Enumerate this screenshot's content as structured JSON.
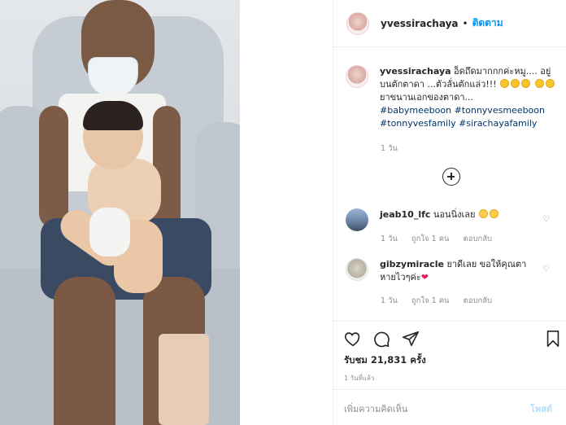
{
  "post": {
    "username": "yvessirachaya",
    "follow_label": "ติดตาม",
    "dot": "•",
    "caption_text_line1": "อ็ดถึดมากกกค่ะหมู.... อยู่บนตักตาดา ...ตัวลั่นตักแล่ว!!!",
    "caption_text_line2": "ยาขนานเอกของตาดา...",
    "hashtags_line1": "#babymeeboon #tonnyvesmeeboon",
    "hashtags_line2": "#tonnyvesfamily #sirachayafamily",
    "caption_time": "1 วัน"
  },
  "comments": [
    {
      "username": "jeab10_lfc",
      "text": "นอนนิ่งเลย",
      "time": "1 วัน",
      "likes": "ถูกใจ 1 คน",
      "reply": "ตอบกลับ"
    },
    {
      "username": "gibzymiracle",
      "text": "ยาดีเลย ขอให้คุณตาหายไวๆค่ะ",
      "heart": "❤",
      "time": "1 วัน",
      "likes": "ถูกใจ 1 คน",
      "reply": "ตอบกลับ"
    }
  ],
  "footer": {
    "views": "รับชม 21,831 ครั้ง",
    "post_time": "1 วันที่แล้ว",
    "comment_placeholder": "เพิ่มความคิดเห็น",
    "post_label": "โพสต์"
  },
  "colors": {
    "accent": "#0095f6",
    "hashtag": "#003569",
    "muted": "#8e8e8e",
    "post_disabled": "#b2dffc"
  },
  "icons": [
    "heart-icon",
    "comment-icon",
    "share-icon",
    "bookmark-icon",
    "plus-circle-icon"
  ]
}
